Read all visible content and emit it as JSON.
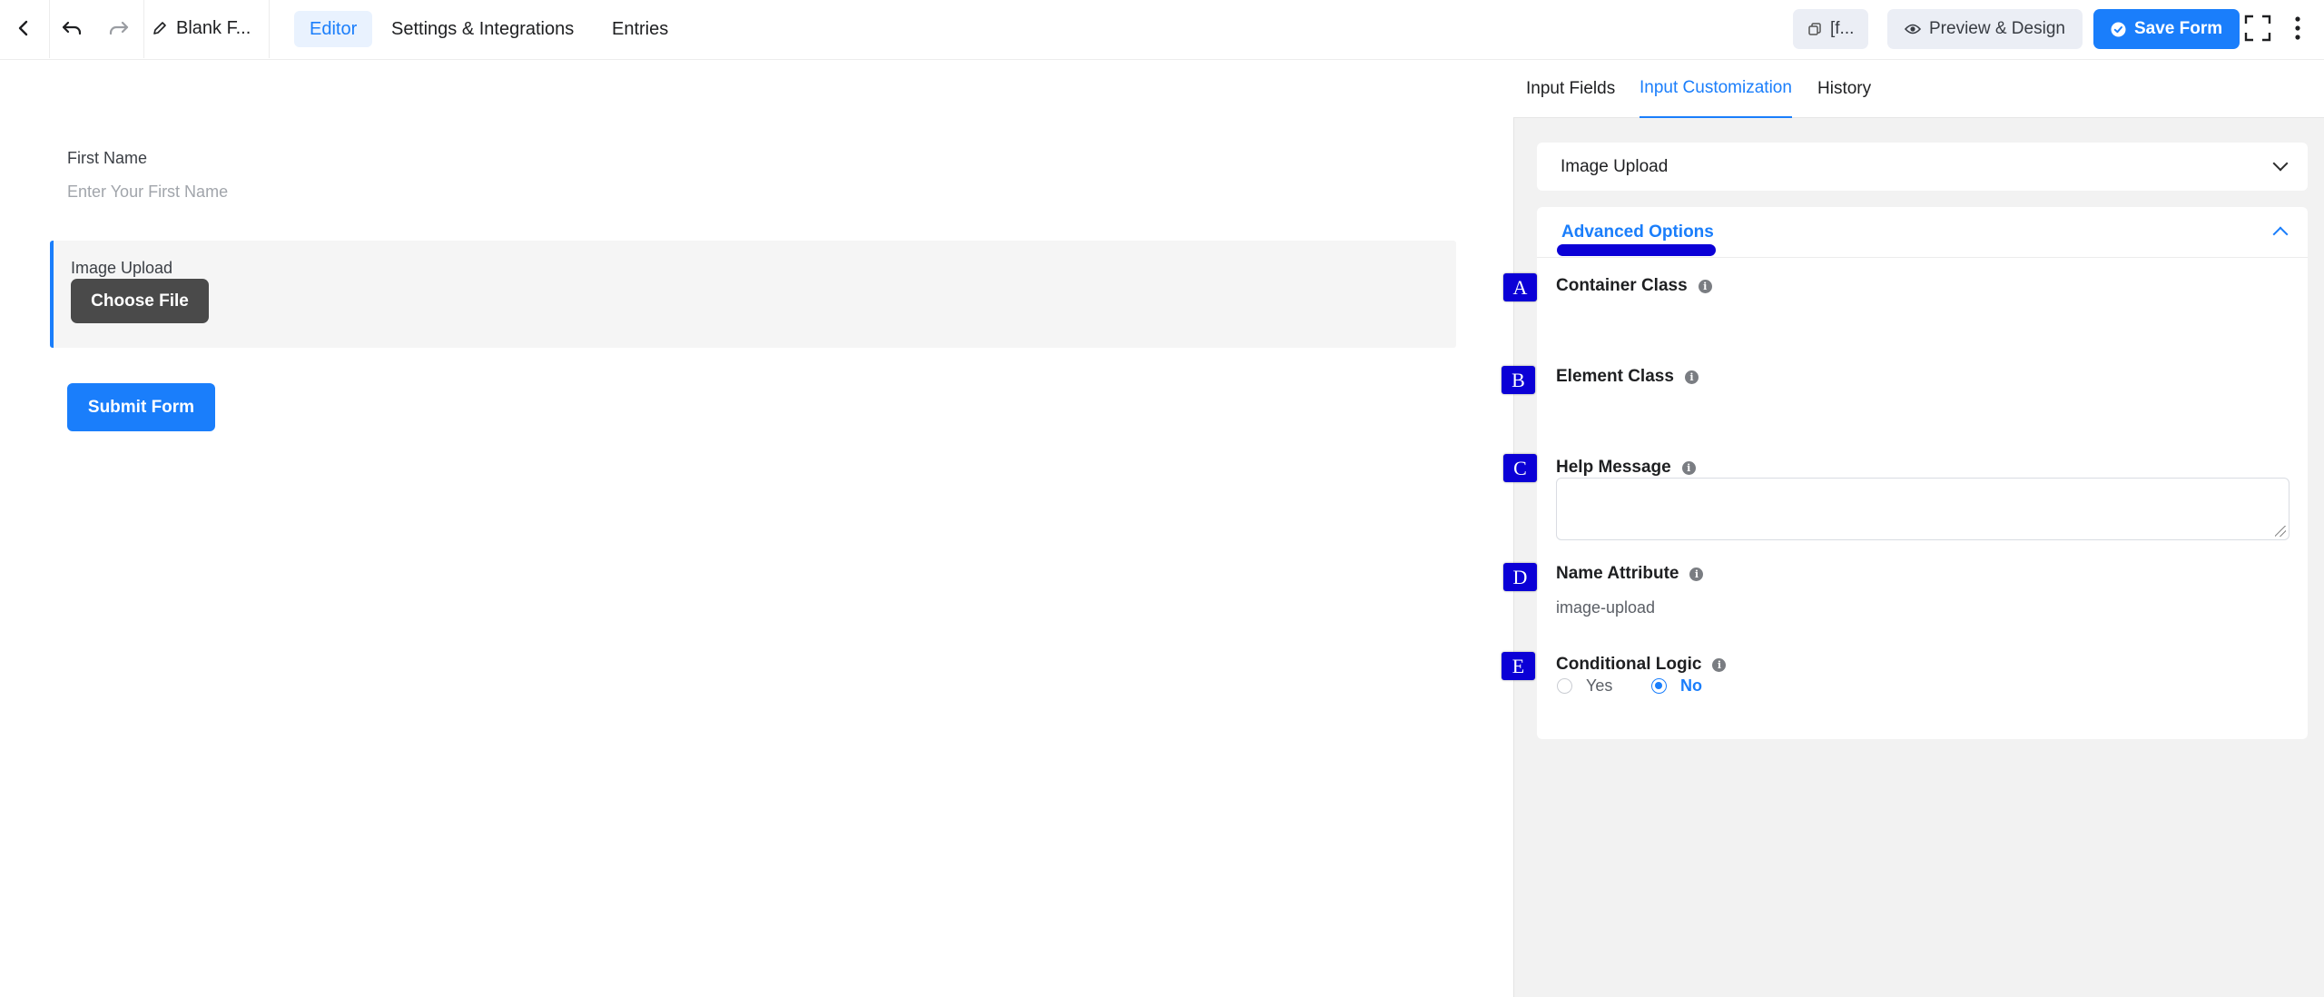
{
  "topbar": {
    "form_title": "Blank F...",
    "tabs": [
      {
        "label": "Editor",
        "active": true
      },
      {
        "label": "Settings & Integrations",
        "active": false
      },
      {
        "label": "Entries",
        "active": false
      }
    ],
    "shortcode_label": "[f...",
    "preview_label": "Preview & Design",
    "save_label": "Save Form"
  },
  "editor": {
    "first_name": {
      "label": "First Name",
      "placeholder": "Enter Your First Name"
    },
    "image_upload": {
      "label": "Image Upload",
      "button": "Choose File"
    },
    "submit_label": "Submit Form"
  },
  "sidebar": {
    "tabs": [
      {
        "label": "Input Fields",
        "active": false
      },
      {
        "label": "Input Customization",
        "active": true
      },
      {
        "label": "History",
        "active": false
      }
    ],
    "collapsed_section": "Image Upload",
    "advanced_section": "Advanced Options",
    "options": [
      {
        "marker": "A",
        "label": "Container Class"
      },
      {
        "marker": "B",
        "label": "Element Class"
      },
      {
        "marker": "C",
        "label": "Help Message"
      },
      {
        "marker": "D",
        "label": "Name Attribute",
        "value": "image-upload"
      },
      {
        "marker": "E",
        "label": "Conditional Logic"
      }
    ],
    "conditional_logic": {
      "options": [
        "Yes",
        "No"
      ],
      "selected": "No"
    }
  },
  "colors": {
    "accent": "#1a7efb",
    "marker": "#0b00d6",
    "dark_button": "#4a4a4a"
  }
}
